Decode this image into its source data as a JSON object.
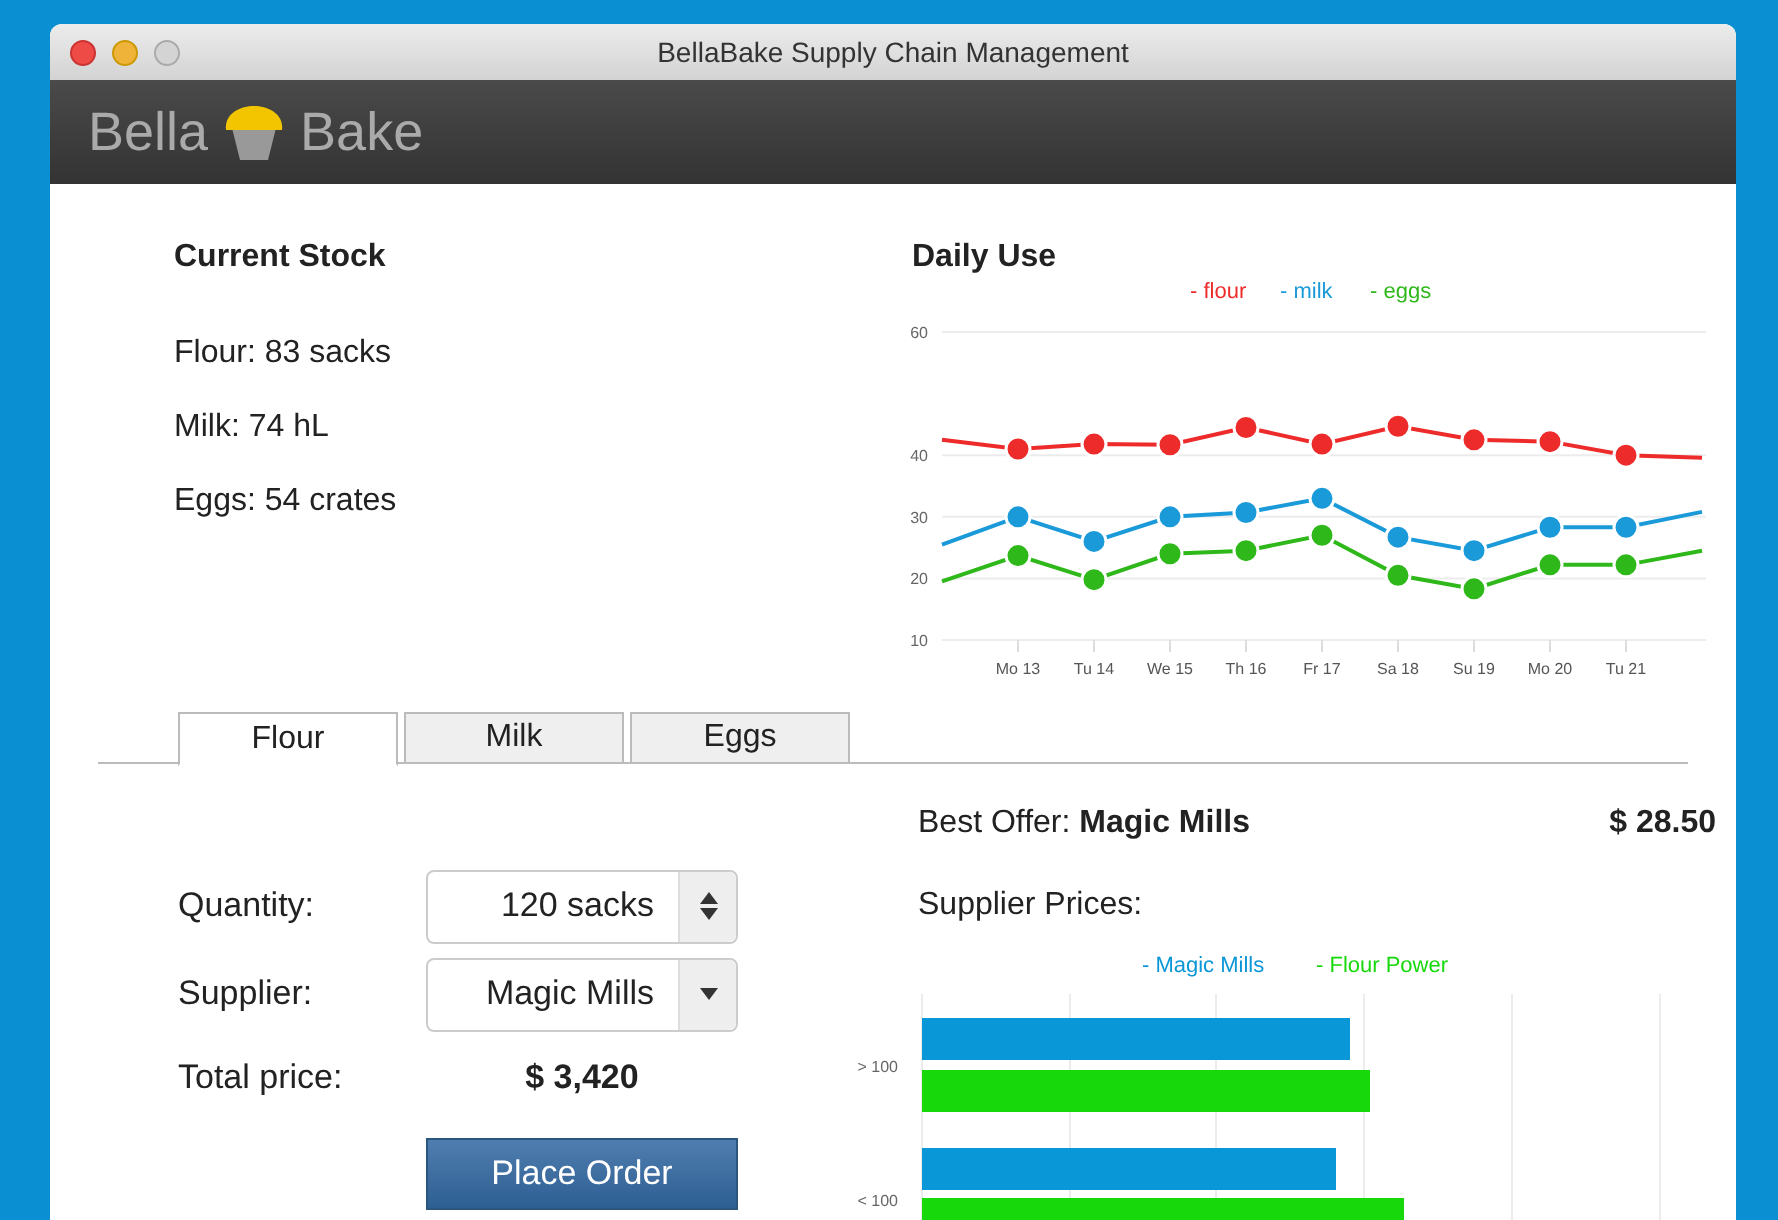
{
  "window": {
    "title": "BellaBake Supply Chain Management"
  },
  "header": {
    "logo_left": "Bella",
    "logo_right": "Bake"
  },
  "current_stock": {
    "title": "Current Stock",
    "items": [
      "Flour: 83 sacks",
      "Milk: 74 hL",
      "Eggs: 54 crates"
    ]
  },
  "daily_use": {
    "title": "Daily Use",
    "chart_data": {
      "type": "line",
      "categories": [
        null,
        "Mo 13",
        "Tu 14",
        "We 15",
        "Th 16",
        "Fr 17",
        "Sa 18",
        "Su 19",
        "Mo 20",
        "Tu 21",
        null
      ],
      "ylim": [
        10,
        60
      ],
      "yticks": [
        10,
        20,
        30,
        40,
        60
      ],
      "grid": true,
      "series": [
        {
          "name": "- flour",
          "color": "#ee2b2b",
          "marker": "circle",
          "values": [
            42.5,
            41,
            41.8,
            41.7,
            44.5,
            41.8,
            44.7,
            42.5,
            42.2,
            40,
            39.6
          ]
        },
        {
          "name": "- milk",
          "color": "#1a9ad9",
          "marker": "circle",
          "values": [
            25.5,
            30,
            26,
            30,
            30.7,
            33,
            26.7,
            24.5,
            28.3,
            28.3,
            30.8
          ]
        },
        {
          "name": "- eggs",
          "color": "#2fb81a",
          "marker": "circle",
          "values": [
            19.5,
            23.7,
            19.8,
            24,
            24.5,
            27,
            20.5,
            18.3,
            22.2,
            22.2,
            24.5
          ]
        }
      ]
    }
  },
  "tabs": [
    {
      "label": "Flour",
      "selected": true
    },
    {
      "label": "Milk",
      "selected": false
    },
    {
      "label": "Eggs",
      "selected": false
    }
  ],
  "order_form": {
    "quantity_label": "Quantity:",
    "quantity_value": "120 sacks",
    "supplier_label": "Supplier:",
    "supplier_value": "Magic Mills",
    "total_label": "Total price:",
    "total_value": "$ 3,420",
    "button": "Place Order"
  },
  "best_offer": {
    "label": "Best Offer:",
    "supplier": "Magic Mills",
    "price": "$ 28.50"
  },
  "supplier_prices": {
    "title": "Supplier Prices:",
    "legend": [
      {
        "name": "- Magic Mills",
        "color": "#0a97d8"
      },
      {
        "name": "- Flour Power",
        "color": "#17d80a"
      }
    ],
    "categories": [
      "> 100",
      "< 100"
    ]
  }
}
